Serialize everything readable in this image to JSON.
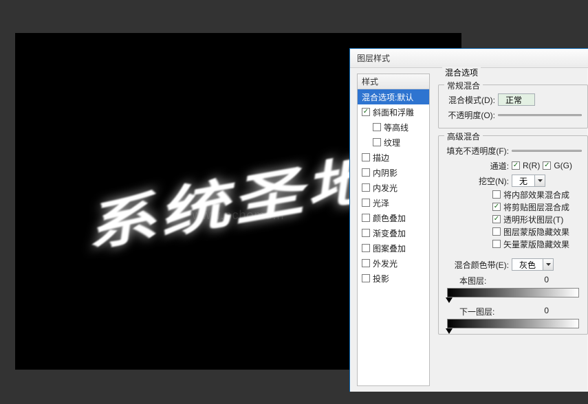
{
  "canvas": {
    "text": "系统圣地",
    "watermark": "www.pchome.n"
  },
  "dialog": {
    "title": "图层样式",
    "styles_header": "样式",
    "options_header": "混合选项",
    "style_list": [
      {
        "label": "混合选项:默认",
        "checkable": false,
        "checked": false,
        "selected": true,
        "indent": false
      },
      {
        "label": "斜面和浮雕",
        "checkable": true,
        "checked": true,
        "selected": false,
        "indent": false
      },
      {
        "label": "等高线",
        "checkable": true,
        "checked": false,
        "selected": false,
        "indent": true
      },
      {
        "label": "纹理",
        "checkable": true,
        "checked": false,
        "selected": false,
        "indent": true
      },
      {
        "label": "描边",
        "checkable": true,
        "checked": false,
        "selected": false,
        "indent": false
      },
      {
        "label": "内阴影",
        "checkable": true,
        "checked": false,
        "selected": false,
        "indent": false
      },
      {
        "label": "内发光",
        "checkable": true,
        "checked": false,
        "selected": false,
        "indent": false
      },
      {
        "label": "光泽",
        "checkable": true,
        "checked": false,
        "selected": false,
        "indent": false
      },
      {
        "label": "颜色叠加",
        "checkable": true,
        "checked": false,
        "selected": false,
        "indent": false
      },
      {
        "label": "渐变叠加",
        "checkable": true,
        "checked": false,
        "selected": false,
        "indent": false
      },
      {
        "label": "图案叠加",
        "checkable": true,
        "checked": false,
        "selected": false,
        "indent": false
      },
      {
        "label": "外发光",
        "checkable": true,
        "checked": false,
        "selected": false,
        "indent": false
      },
      {
        "label": "投影",
        "checkable": true,
        "checked": false,
        "selected": false,
        "indent": false
      }
    ],
    "general": {
      "title": "常规混合",
      "blend_mode_label": "混合模式(D):",
      "blend_mode_value": "正常",
      "opacity_label": "不透明度(O):"
    },
    "advanced": {
      "title": "高级混合",
      "fill_opacity_label": "填充不透明度(F):",
      "channels_label": "通道:",
      "ch_r": "R(R)",
      "ch_g": "G(G)",
      "knockout_label": "挖空(N):",
      "knockout_value": "无",
      "opts": [
        {
          "checked": false,
          "label": "将内部效果混合成"
        },
        {
          "checked": true,
          "label": "将剪贴图层混合成"
        },
        {
          "checked": true,
          "label": "透明形状图层(T)"
        },
        {
          "checked": false,
          "label": "图层蒙版隐藏效果"
        },
        {
          "checked": false,
          "label": "矢量蒙版隐藏效果"
        }
      ]
    },
    "blend_if": {
      "label": "混合颜色带(E):",
      "value": "灰色",
      "this_label": "本图层:",
      "this_low": "0",
      "under_label": "下一图层:",
      "under_low": "0"
    }
  }
}
